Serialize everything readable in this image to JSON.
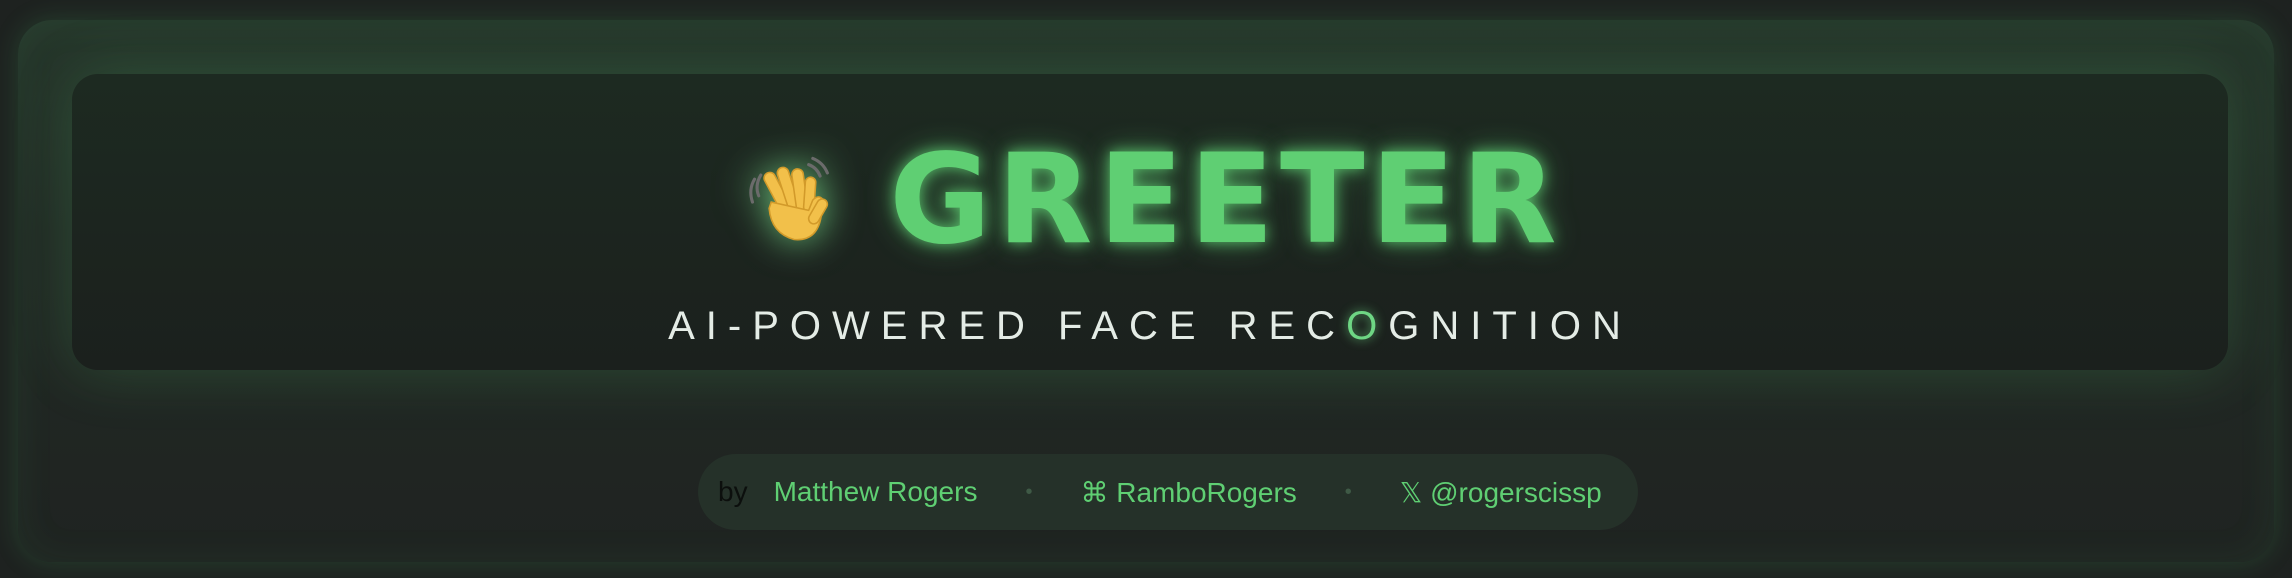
{
  "hero": {
    "icon": "waving-hand-icon",
    "title": "GREETER",
    "subtitle_pre": "AI-POWERED FACE REC",
    "subtitle_accent": "O",
    "subtitle_post": "GNITION"
  },
  "credits": {
    "by": "by",
    "author": "Matthew Rogers",
    "separator": "•",
    "github": "⌘ RamboRogers",
    "twitter": "𝕏 @rogerscissp"
  },
  "colors": {
    "accent": "#5fcf73",
    "background": "#1e2220",
    "panel": "#1b201d",
    "pill": "#253129"
  }
}
